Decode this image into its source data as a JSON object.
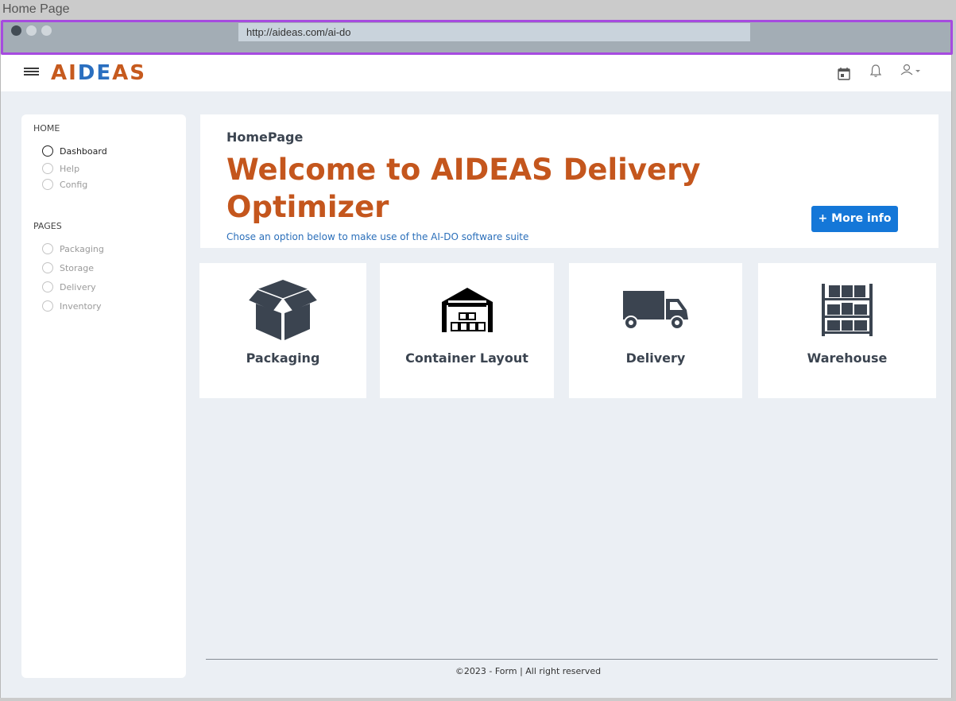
{
  "page_title": "Home Page",
  "browser": {
    "url": "http://aideas.com/ai-do"
  },
  "header": {
    "logo_part1": "AI",
    "logo_part2": "DE",
    "logo_part3": "AS",
    "icons": [
      "calendar-icon",
      "bell-icon",
      "user-menu-icon"
    ]
  },
  "sidebar": {
    "home_section": "HOME",
    "home_items": [
      {
        "label": "Dashboard",
        "active": true
      },
      {
        "label": "Help",
        "active": false
      },
      {
        "label": "Config",
        "active": false
      }
    ],
    "pages_section": "PAGES",
    "pages_items": [
      {
        "label": "Packaging"
      },
      {
        "label": "Storage"
      },
      {
        "label": "Delivery"
      },
      {
        "label": "Inventory"
      }
    ]
  },
  "hero": {
    "subtitle": "HomePage",
    "title": "Welcome to AIDEAS Delivery Optimizer",
    "description": "Chose an option below to make use of the AI-DO software suite",
    "button_label": "+ More info"
  },
  "cards": [
    {
      "label": "Packaging",
      "icon": "open-box-icon"
    },
    {
      "label": "Container Layout",
      "icon": "warehouse-icon"
    },
    {
      "label": "Delivery",
      "icon": "truck-icon"
    },
    {
      "label": "Warehouse",
      "icon": "shelving-icon"
    }
  ],
  "footer": {
    "text": "©2023 - Form  |   All right reserved"
  },
  "colors": {
    "accent_orange": "#c4561d",
    "accent_blue": "#1477d8",
    "background": "#ebeff4",
    "browser_highlight": "#a64bdf"
  }
}
